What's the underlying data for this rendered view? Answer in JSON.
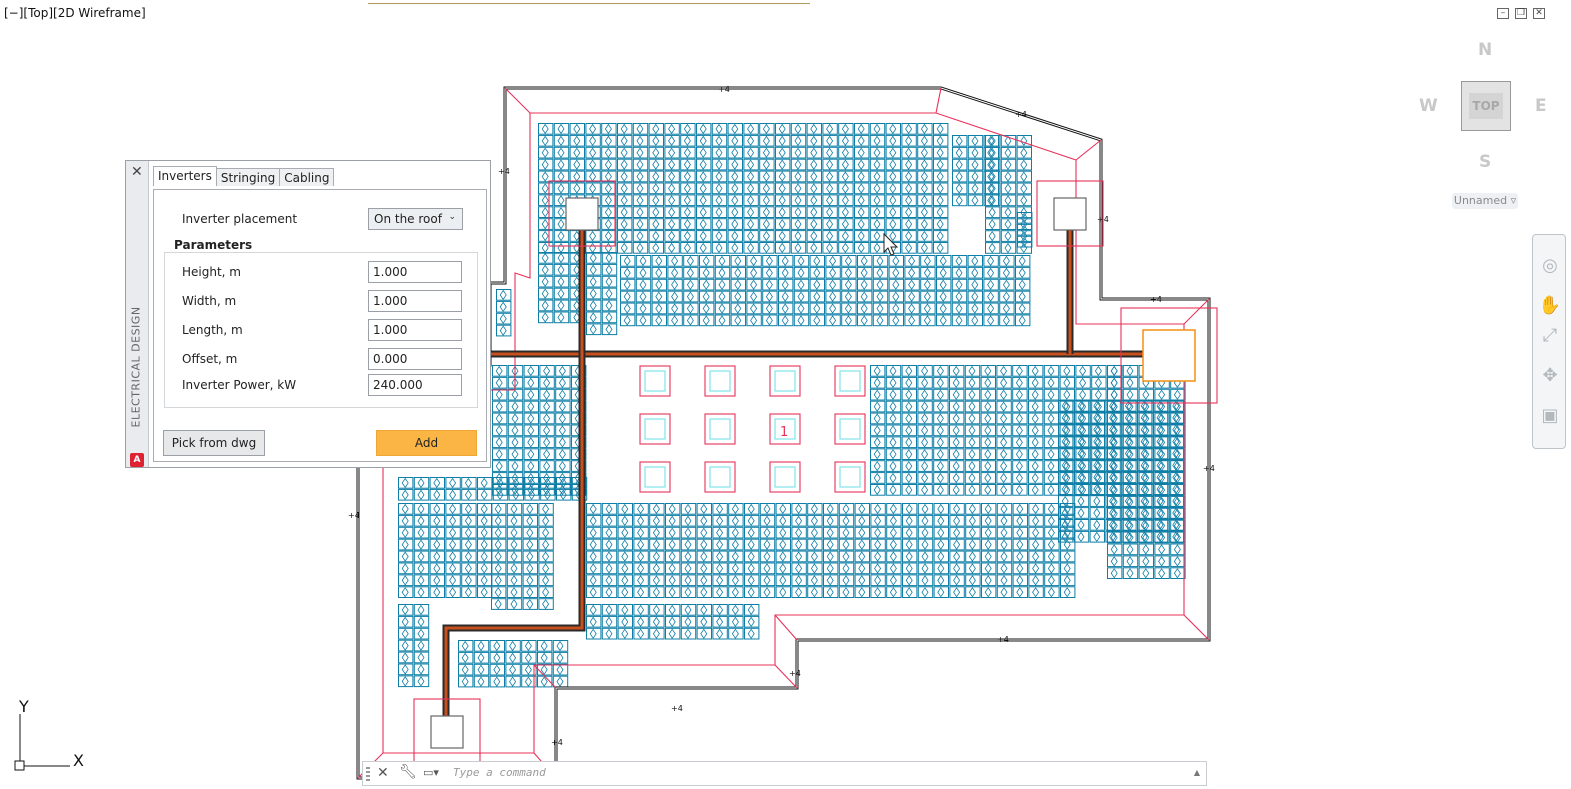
{
  "viewport": {
    "label": "[−][Top][2D Wireframe]"
  },
  "window_controls": [
    "minimize",
    "restore",
    "close"
  ],
  "viewcube": {
    "north": "N",
    "south": "S",
    "east": "E",
    "west": "W",
    "face": "TOP"
  },
  "ucs_dropdown": {
    "label": "Unnamed ▿"
  },
  "navbar": {
    "icons": [
      "steering-wheel-icon",
      "pan-icon",
      "zoom-extents-icon",
      "orbit-icon",
      "showmotion-icon"
    ]
  },
  "palette": {
    "side_title": "ELECTRICAL DESIGN",
    "logo": "A",
    "tabs": [
      "Inverters",
      "Stringing",
      "Cabling"
    ],
    "active_tab": "Inverters",
    "placement": {
      "label": "Inverter placement",
      "value": "On the roof"
    },
    "parameters": {
      "title": "Parameters",
      "height": {
        "label": "Height, m",
        "value": "1.000"
      },
      "width": {
        "label": "Width, m",
        "value": "1.000"
      },
      "length": {
        "label": "Length, m",
        "value": "1.000"
      },
      "offset": {
        "label": "Offset, m",
        "value": "0.000"
      },
      "power": {
        "label": "Inverter Power, kW",
        "value": "240.000"
      }
    },
    "pick_label": "Pick from dwg",
    "add_label": "Add"
  },
  "drawing": {
    "dimension_label": "4",
    "tile_number": "1",
    "colors": {
      "panel": "#0e7ea6",
      "boundary": "#e8315a",
      "wall": "#111111",
      "cable": "#c8501e",
      "inverter_selected": "#f39012",
      "tile": "#7fe3ea"
    }
  },
  "ucs": {
    "x": "X",
    "y": "Y"
  },
  "command": {
    "placeholder": "Type a command",
    "prompt_icon": "▭▾"
  }
}
